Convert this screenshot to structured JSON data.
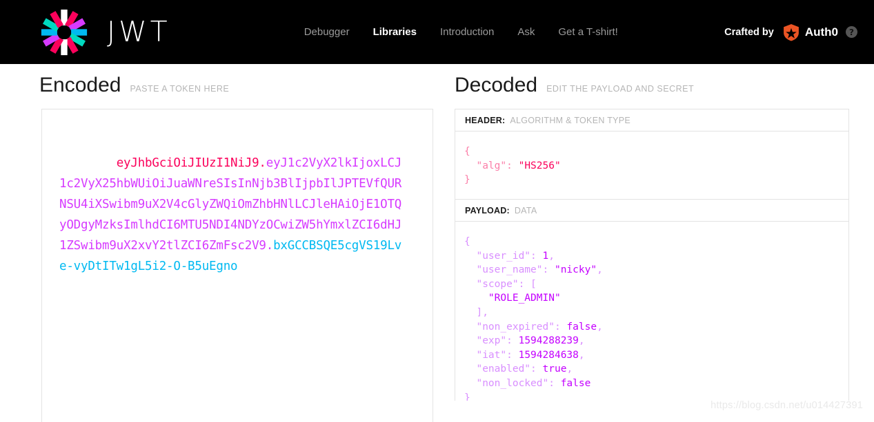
{
  "navbar": {
    "brand_word": "JWT",
    "logo_icon": "jwt-starburst-logo",
    "links": [
      {
        "label": "Debugger",
        "active": false
      },
      {
        "label": "Libraries",
        "active": true
      },
      {
        "label": "Introduction",
        "active": false
      },
      {
        "label": "Ask",
        "active": false
      },
      {
        "label": "Get a T-shirt!",
        "active": false
      }
    ],
    "crafted_by_label": "Crafted by",
    "auth0_label": "Auth0",
    "auth0_icon": "auth0-shield-icon",
    "help_icon": "question-mark-icon",
    "help_icon_glyph": "?"
  },
  "encoded": {
    "title": "Encoded",
    "subtitle": "PASTE A TOKEN HERE",
    "token": {
      "header": "eyJhbGciOiJIUzI1NiJ9",
      "payload": "eyJ1c2VyX2lkIjoxLCJ1c2VyX25hbWUiOiJuaWNreSIsInNjb3BlIjpbIlJPTEVfQURNSU4iXSwibm9uX2V4cGlyZWQiOmZhbHNlLCJleHAiOjE1OTQyODgyMzksImlhdCI6MTU5NDI4NDYzOCwiZW5hYmxlZCI6dHJ1ZSwibm9uX2xvY2tlZCI6ZmFsc2V9",
      "signature": "bxGCCBSQE5cgVS19Lve-vyDtITw1gL5i2-O-B5uEgno",
      "separator": "."
    },
    "colors": {
      "header": "#fb015b",
      "payload": "#d63aff",
      "signature": "#00b9f1"
    }
  },
  "decoded": {
    "title": "Decoded",
    "subtitle": "EDIT THE PAYLOAD AND SECRET",
    "header_panel": {
      "label": "HEADER:",
      "label_sub": "ALGORITHM & TOKEN TYPE",
      "lines": [
        {
          "indent": 0,
          "parts": [
            {
              "t": "{",
              "c": "punct"
            }
          ]
        },
        {
          "indent": 1,
          "parts": [
            {
              "t": "\"alg\"",
              "c": "key"
            },
            {
              "t": ": ",
              "c": "punct"
            },
            {
              "t": "\"HS256\"",
              "c": "val"
            }
          ]
        },
        {
          "indent": 0,
          "parts": [
            {
              "t": "}",
              "c": "punct"
            }
          ]
        }
      ]
    },
    "payload_panel": {
      "label": "PAYLOAD:",
      "label_sub": "DATA",
      "lines": [
        {
          "indent": 0,
          "parts": [
            {
              "t": "{",
              "c": "punct"
            }
          ]
        },
        {
          "indent": 1,
          "parts": [
            {
              "t": "\"user_id\"",
              "c": "key"
            },
            {
              "t": ": ",
              "c": "punct"
            },
            {
              "t": "1",
              "c": "val"
            },
            {
              "t": ",",
              "c": "punct"
            }
          ]
        },
        {
          "indent": 1,
          "parts": [
            {
              "t": "\"user_name\"",
              "c": "key"
            },
            {
              "t": ": ",
              "c": "punct"
            },
            {
              "t": "\"nicky\"",
              "c": "val"
            },
            {
              "t": ",",
              "c": "punct"
            }
          ]
        },
        {
          "indent": 1,
          "parts": [
            {
              "t": "\"scope\"",
              "c": "key"
            },
            {
              "t": ": [",
              "c": "punct"
            }
          ]
        },
        {
          "indent": 2,
          "parts": [
            {
              "t": "\"ROLE_ADMIN\"",
              "c": "val"
            }
          ]
        },
        {
          "indent": 1,
          "parts": [
            {
              "t": "],",
              "c": "punct"
            }
          ]
        },
        {
          "indent": 1,
          "parts": [
            {
              "t": "\"non_expired\"",
              "c": "key"
            },
            {
              "t": ": ",
              "c": "punct"
            },
            {
              "t": "false",
              "c": "val"
            },
            {
              "t": ",",
              "c": "punct"
            }
          ]
        },
        {
          "indent": 1,
          "parts": [
            {
              "t": "\"exp\"",
              "c": "key"
            },
            {
              "t": ": ",
              "c": "punct"
            },
            {
              "t": "1594288239",
              "c": "val"
            },
            {
              "t": ",",
              "c": "punct"
            }
          ]
        },
        {
          "indent": 1,
          "parts": [
            {
              "t": "\"iat\"",
              "c": "key"
            },
            {
              "t": ": ",
              "c": "punct"
            },
            {
              "t": "1594284638",
              "c": "val"
            },
            {
              "t": ",",
              "c": "punct"
            }
          ]
        },
        {
          "indent": 1,
          "parts": [
            {
              "t": "\"enabled\"",
              "c": "key"
            },
            {
              "t": ": ",
              "c": "punct"
            },
            {
              "t": "true",
              "c": "val"
            },
            {
              "t": ",",
              "c": "punct"
            }
          ]
        },
        {
          "indent": 1,
          "parts": [
            {
              "t": "\"non_locked\"",
              "c": "key"
            },
            {
              "t": ": ",
              "c": "punct"
            },
            {
              "t": "false",
              "c": "val"
            }
          ]
        },
        {
          "indent": 0,
          "parts": [
            {
              "t": "}",
              "c": "punct"
            }
          ]
        }
      ]
    }
  },
  "watermark": "https://blog.csdn.net/u014427391"
}
